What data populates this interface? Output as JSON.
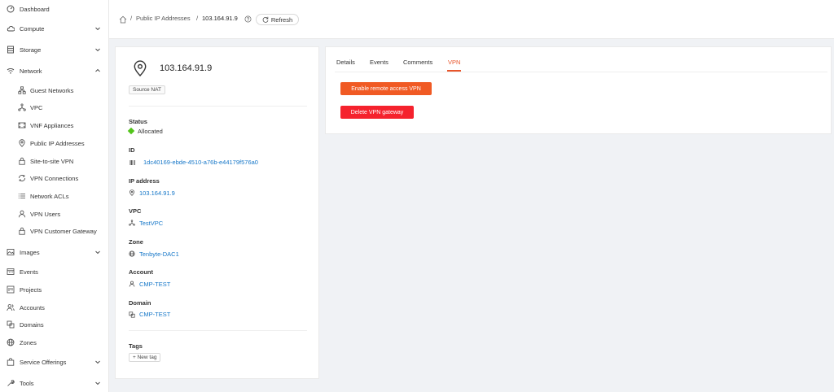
{
  "sidebar": {
    "items": [
      {
        "label": "Dashboard",
        "icon": "dashboard-icon"
      },
      {
        "label": "Compute",
        "icon": "cloud-icon"
      },
      {
        "label": "Storage",
        "icon": "storage-icon"
      },
      {
        "label": "Network",
        "icon": "wifi-icon"
      },
      {
        "label": "Guest Networks",
        "icon": "network-icon"
      },
      {
        "label": "VPC",
        "icon": "vpc-icon"
      },
      {
        "label": "VNF Appliances",
        "icon": "vnf-icon"
      },
      {
        "label": "Public IP Addresses",
        "icon": "location-icon"
      },
      {
        "label": "Site-to-site VPN",
        "icon": "lock-icon"
      },
      {
        "label": "VPN Connections",
        "icon": "sync-icon"
      },
      {
        "label": "Network ACLs",
        "icon": "list-icon"
      },
      {
        "label": "VPN Users",
        "icon": "user-icon"
      },
      {
        "label": "VPN Customer Gateway",
        "icon": "lock-icon"
      },
      {
        "label": "Images",
        "icon": "image-icon"
      },
      {
        "label": "Events",
        "icon": "schedule-icon"
      },
      {
        "label": "Projects",
        "icon": "project-icon"
      },
      {
        "label": "Accounts",
        "icon": "team-icon"
      },
      {
        "label": "Domains",
        "icon": "domain-icon"
      },
      {
        "label": "Zones",
        "icon": "globe-icon"
      },
      {
        "label": "Service Offerings",
        "icon": "shopping-icon"
      },
      {
        "label": "Tools",
        "icon": "tool-icon"
      }
    ]
  },
  "breadcrumb": {
    "home_icon": "home-icon",
    "sep": "/",
    "parent": "Public IP Addresses",
    "current": "103.164.91.9"
  },
  "toolbar": {
    "refresh_label": "Refresh"
  },
  "detail": {
    "title": "103.164.91.9",
    "badge": "Source NAT",
    "status_label": "Status",
    "status_value": "Allocated",
    "status_color": "#52c41a",
    "id_label": "ID",
    "id_value": "1dc40169-ebde-4510-a76b-e44179f576a0",
    "ip_label": "IP address",
    "ip_value": "103.164.91.9",
    "vpc_label": "VPC",
    "vpc_value": "TestVPC",
    "zone_label": "Zone",
    "zone_value": "Tenbyte-DAC1",
    "account_label": "Account",
    "account_value": "CMP-TEST",
    "domain_label": "Domain",
    "domain_value": "CMP-TEST",
    "tags_label": "Tags",
    "new_tag_label": "+ New tag"
  },
  "tabs": [
    "Details",
    "Events",
    "Comments",
    "VPN"
  ],
  "active_tab": "VPN",
  "vpn": {
    "enable_label": "Enable remote access VPN",
    "delete_label": "Delete VPN gateway",
    "enable_color": "#f05a24",
    "delete_color": "#f5222d"
  },
  "colors": {
    "accent": "#e8552b",
    "link": "#1677c8"
  }
}
